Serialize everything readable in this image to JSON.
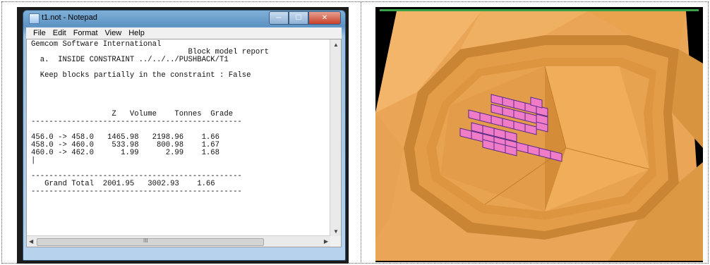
{
  "notepad": {
    "title": "t1.not - Notepad",
    "menu": [
      "File",
      "Edit",
      "Format",
      "View",
      "Help"
    ],
    "report_lines": [
      "Gemcom Software International",
      "                                   Block model report",
      "  a.  INSIDE CONSTRAINT ../../../PUSHBACK/T1",
      "",
      "  Keep blocks partially in the constraint : False",
      "",
      "",
      "",
      "",
      "                  Z   Volume    Tonnes  Grade",
      "-----------------------------------------------",
      "",
      "456.0 -> 458.0   1465.98   2198.96    1.66",
      "458.0 -> 460.0    533.98    800.98    1.67",
      "460.0 -> 462.0      1.99      2.99    1.68",
      "|",
      "",
      "-----------------------------------------------",
      "   Grand Total  2001.95   3002.93    1.66",
      "-----------------------------------------------"
    ],
    "hscroll_label": "III"
  },
  "viewer": {
    "colors": {
      "background": "#000000",
      "surface": "#e8a450",
      "surface_dark": "#b8742a",
      "block": "#f07cc8",
      "block_edge": "#5a2a8a",
      "top_border": "#3aa24a"
    }
  }
}
